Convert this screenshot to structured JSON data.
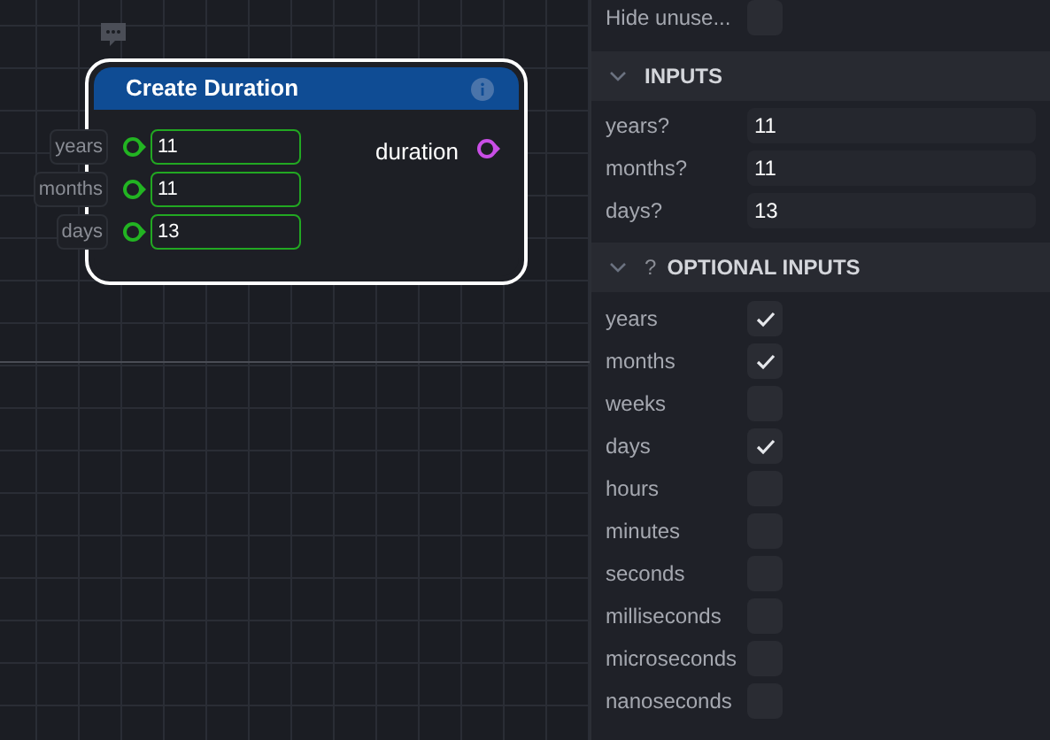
{
  "node": {
    "title": "Create Duration",
    "inputs": [
      {
        "label": "years",
        "value": "11"
      },
      {
        "label": "months",
        "value": "11"
      },
      {
        "label": "days",
        "value": "13"
      }
    ],
    "output": {
      "label": "duration"
    }
  },
  "panel": {
    "hide_unused": {
      "label": "Hide unuse...",
      "checked": false
    },
    "inputs_section": {
      "title": "INPUTS",
      "expanded": true,
      "fields": [
        {
          "label": "years?",
          "value": "11"
        },
        {
          "label": "months?",
          "value": "11"
        },
        {
          "label": "days?",
          "value": "13"
        }
      ]
    },
    "optional_section": {
      "help": "?",
      "title": "OPTIONAL INPUTS",
      "expanded": true,
      "options": [
        {
          "label": "years",
          "checked": true
        },
        {
          "label": "months",
          "checked": true
        },
        {
          "label": "weeks",
          "checked": false
        },
        {
          "label": "days",
          "checked": true
        },
        {
          "label": "hours",
          "checked": false
        },
        {
          "label": "minutes",
          "checked": false
        },
        {
          "label": "seconds",
          "checked": false
        },
        {
          "label": "milliseconds",
          "checked": false
        },
        {
          "label": "microseconds",
          "checked": false
        },
        {
          "label": "nanoseconds",
          "checked": false
        }
      ]
    }
  }
}
